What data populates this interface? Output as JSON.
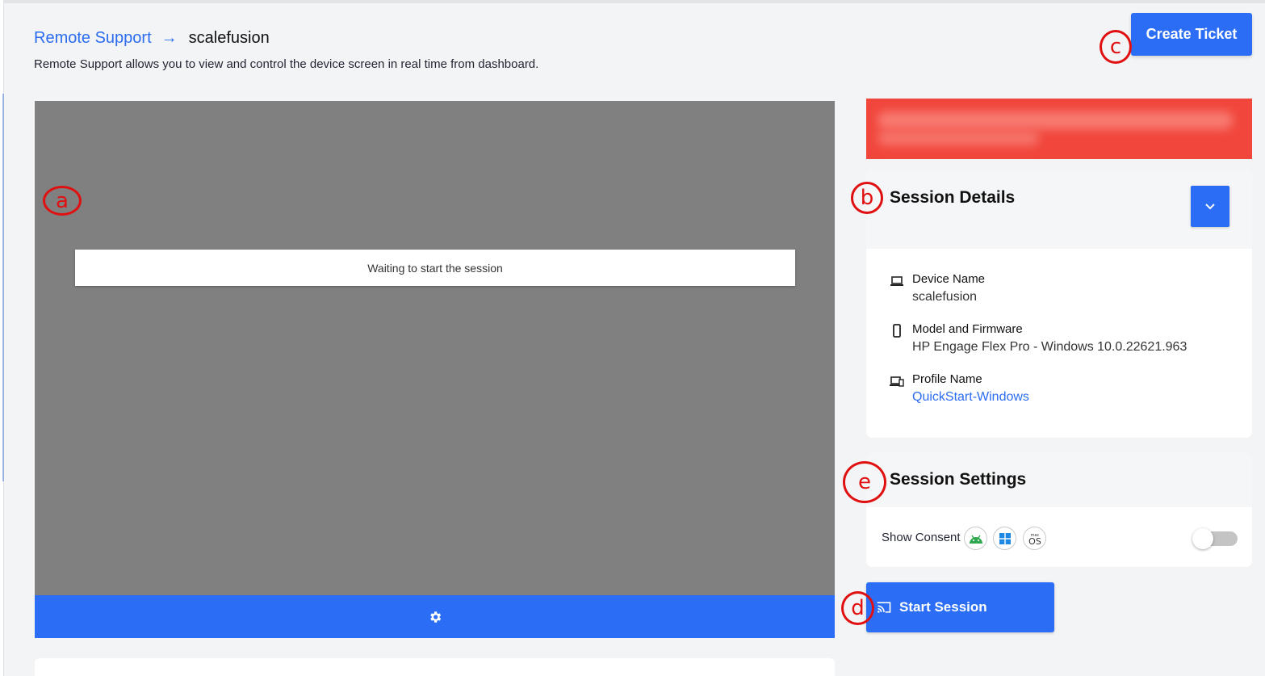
{
  "breadcrumb": {
    "parent": "Remote Support",
    "separator": "→",
    "current": "scalefusion"
  },
  "subtitle": "Remote Support allows you to view and control the device screen in real time from dashboard.",
  "actions": {
    "create_ticket": "Create Ticket"
  },
  "viewer": {
    "status_text": "Waiting to start the session",
    "toolbar_icon": "gear-icon"
  },
  "session_details": {
    "title": "Session Details",
    "toggle_icon": "chevron-down-icon",
    "items": [
      {
        "icon": "laptop-icon",
        "label": "Device Name",
        "value": "scalefusion"
      },
      {
        "icon": "phone-icon",
        "label": "Model and Firmware",
        "value": "HP Engage Flex Pro - Windows 10.0.22621.963"
      },
      {
        "icon": "devices-icon",
        "label": "Profile Name",
        "value": "QuickStart-Windows"
      }
    ]
  },
  "session_settings": {
    "title": "Session Settings",
    "consent_label": "Show Consent",
    "platforms": [
      "android-icon",
      "windows-icon",
      "macos-icon"
    ],
    "consent_enabled": false
  },
  "start_session": {
    "label": "Start Session",
    "icon": "cast-icon"
  },
  "annotations": {
    "a": "a",
    "b": "b",
    "c": "c",
    "d": "d",
    "e": "e"
  },
  "colors": {
    "primary": "#2b6ef5",
    "link": "#2b6cf0",
    "redacted": "#f1463c",
    "marker": "#e01010"
  }
}
